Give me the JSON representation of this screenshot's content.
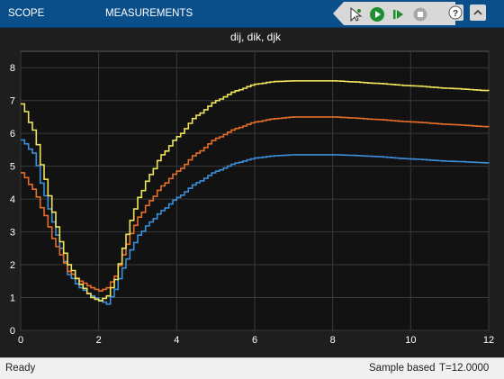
{
  "toolstrip": {
    "tabs": [
      {
        "label": "SCOPE"
      },
      {
        "label": "MEASUREMENTS"
      }
    ],
    "icons": [
      "highlight-signal-icon",
      "run-icon",
      "step-forward-icon",
      "stop-icon",
      "help-icon",
      "collapse-icon"
    ]
  },
  "status": {
    "state": "Ready",
    "mode": "Sample based",
    "time": "T=12.0000"
  },
  "colors": {
    "background": "#1e1e1e",
    "axes": "#121212",
    "grid": "#3a3a3a",
    "text": "#ffffff",
    "series": [
      "#3b8fd8",
      "#e56d2a",
      "#efe35a"
    ]
  },
  "chart_data": {
    "type": "line",
    "title": "dij, dik, djk",
    "xlabel": "",
    "ylabel": "",
    "xlim": [
      0,
      12
    ],
    "ylim": [
      0,
      8.5
    ],
    "xticks": [
      0,
      2,
      4,
      6,
      8,
      10,
      12
    ],
    "yticks": [
      0,
      1,
      2,
      3,
      4,
      5,
      6,
      7,
      8
    ],
    "grid": true,
    "step": true,
    "series": [
      {
        "color": "#3b8fd8",
        "x": [
          0,
          0.3,
          0.6,
          0.8,
          1,
          1.2,
          1.5,
          1.8,
          2,
          2.2,
          2.4,
          2.6,
          2.8,
          3,
          3.3,
          3.6,
          4,
          4.5,
          5,
          5.5,
          6,
          6.5,
          7,
          7.5,
          8,
          8.5,
          9,
          10,
          11,
          12
        ],
        "y": [
          5.8,
          5.4,
          4.1,
          3.3,
          2.5,
          1.7,
          1.3,
          1.05,
          0.92,
          0.8,
          1.25,
          1.9,
          2.45,
          2.9,
          3.3,
          3.65,
          4.05,
          4.5,
          4.85,
          5.1,
          5.25,
          5.32,
          5.35,
          5.35,
          5.35,
          5.33,
          5.3,
          5.22,
          5.15,
          5.1
        ]
      },
      {
        "color": "#e56d2a",
        "x": [
          0,
          0.3,
          0.6,
          0.8,
          1,
          1.2,
          1.5,
          1.8,
          2,
          2.2,
          2.4,
          2.6,
          2.8,
          3,
          3.3,
          3.6,
          4,
          4.5,
          5,
          5.5,
          6,
          6.5,
          7,
          7.5,
          8,
          8.5,
          9,
          10,
          11,
          12
        ],
        "y": [
          4.8,
          4.3,
          3.5,
          2.8,
          2.3,
          1.8,
          1.5,
          1.3,
          1.2,
          1.3,
          1.65,
          2.3,
          2.95,
          3.45,
          3.95,
          4.4,
          4.85,
          5.4,
          5.85,
          6.15,
          6.35,
          6.45,
          6.5,
          6.5,
          6.5,
          6.47,
          6.43,
          6.35,
          6.27,
          6.2
        ]
      },
      {
        "color": "#efe35a",
        "x": [
          0,
          0.3,
          0.6,
          0.8,
          1,
          1.2,
          1.5,
          1.8,
          2,
          2.2,
          2.4,
          2.6,
          2.8,
          3,
          3.3,
          3.6,
          4,
          4.5,
          5,
          5.5,
          6,
          6.5,
          7,
          7.5,
          8,
          8.5,
          9,
          10,
          11,
          12
        ],
        "y": [
          6.9,
          6.1,
          4.6,
          3.6,
          2.7,
          2.0,
          1.4,
          1.0,
          0.9,
          1.05,
          1.55,
          2.5,
          3.35,
          4.05,
          4.75,
          5.35,
          5.9,
          6.55,
          7.0,
          7.3,
          7.5,
          7.58,
          7.6,
          7.6,
          7.6,
          7.57,
          7.53,
          7.45,
          7.37,
          7.3
        ]
      }
    ]
  }
}
